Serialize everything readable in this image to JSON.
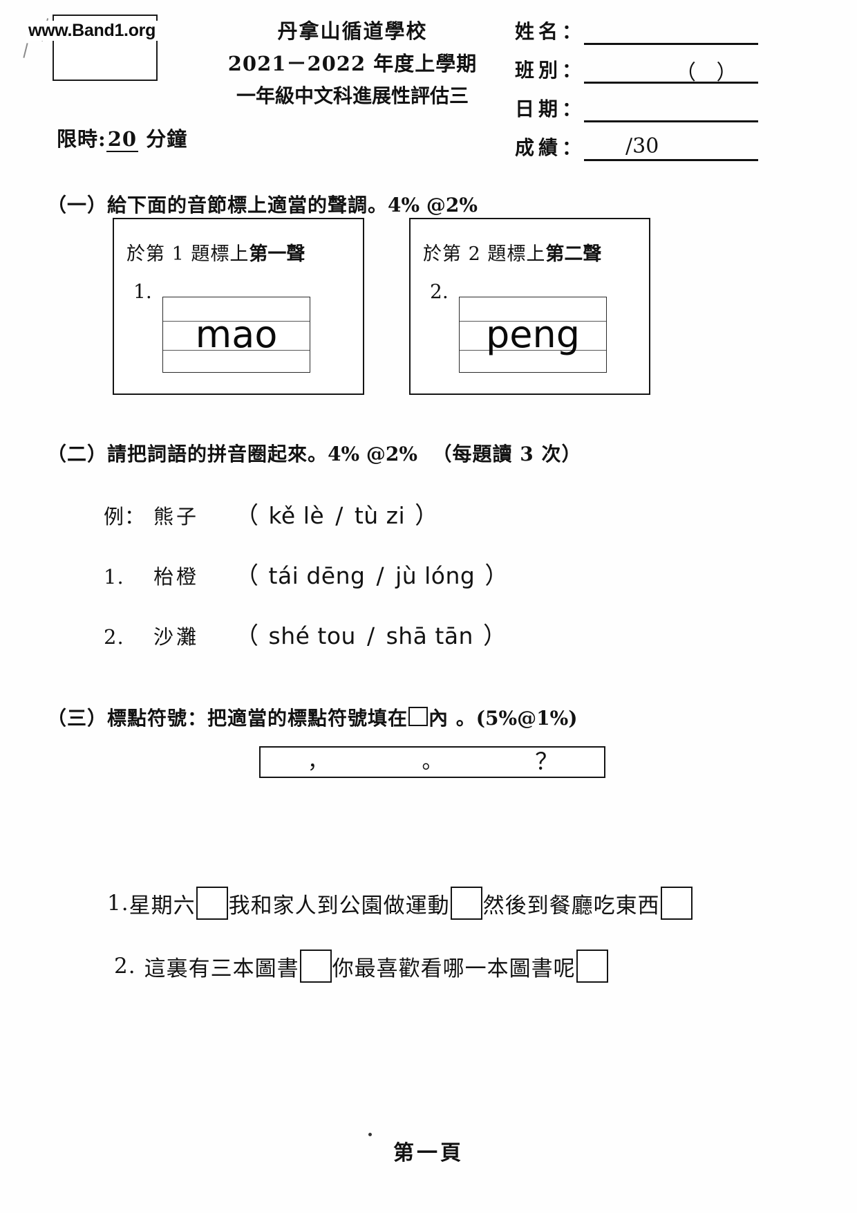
{
  "watermark": {
    "text": "www.Band1.org"
  },
  "header": {
    "school": "丹拿山循道學校",
    "year": "2021－2022 年度上學期",
    "assessment": "一年級中文科進展性評估三",
    "time_limit_prefix": "限時:",
    "time_limit_value": "20",
    "time_limit_unit": "分鐘",
    "fields": [
      {
        "label": "姓名：",
        "extra": ""
      },
      {
        "label": "班別：",
        "extra": "（    ）"
      },
      {
        "label": "日期：",
        "extra": ""
      },
      {
        "label": "成績：",
        "extra": "",
        "score": "/30"
      }
    ]
  },
  "section_one": {
    "number": "（一）",
    "instruction": "給下面的音節標上適當的聲調。",
    "marks": "4%  @2%",
    "boxes": [
      {
        "prompt_pre": "於第 1 題標上",
        "prompt_strong": "第一聲",
        "qnum": "1.",
        "syllable": "mao"
      },
      {
        "prompt_pre": "於第 2 題標上",
        "prompt_strong": "第二聲",
        "qnum": "2.",
        "syllable": "peng"
      }
    ]
  },
  "section_two": {
    "number": "（二）",
    "instruction_pre": "請把詞語的",
    "instruction_strong": "拼音",
    "instruction_post": "圈起來。",
    "marks": "4%  @2%",
    "note": "（每題讀 3 次）",
    "rows": [
      {
        "idx": "例：",
        "word": "熊子",
        "option_a": "kě lè",
        "option_b": "tù  zi"
      },
      {
        "idx": "1.",
        "word": "枱橙",
        "option_a": "tái dēng",
        "option_b": "jù lóng"
      },
      {
        "idx": "2.",
        "word": "沙灘",
        "option_a": "shé tou",
        "option_b": "shā tān"
      }
    ],
    "separator": "/",
    "open_paren": "（",
    "close_paren": "）"
  },
  "section_three": {
    "number": "（三）",
    "instruction_pre": "標點符號：把適當的標點符號填在",
    "instruction_post": "內 。",
    "marks": "(5%@1%)",
    "punctuation_bank": [
      "，",
      "。",
      "？"
    ],
    "sentences": [
      {
        "idx": "1.",
        "parts": [
          "星期六",
          "我和家人到公園做運動",
          "然後到餐廳吃東西"
        ],
        "blanks": 3
      },
      {
        "idx": "2.",
        "parts": [
          "這裏有三本圖書",
          "你最喜歡看哪一本圖書呢"
        ],
        "blanks": 2
      }
    ]
  },
  "footer": {
    "page_label": "第一頁"
  }
}
